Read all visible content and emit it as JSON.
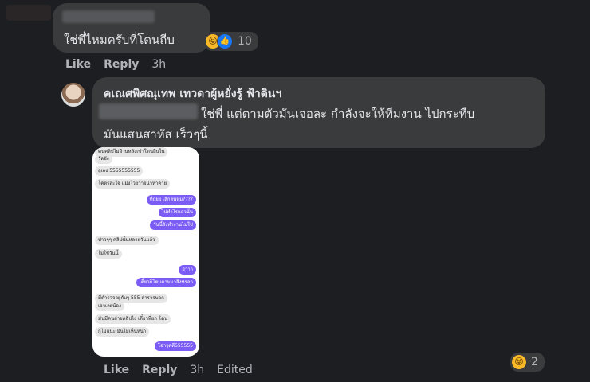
{
  "top_comment": {
    "text": "ใช่พี่ไหมครับที่โดนถีบ",
    "reaction_count": "10",
    "actions": {
      "like": "Like",
      "reply": "Reply",
      "time": "3h"
    }
  },
  "reply": {
    "author": "คเณศพิศณุเทพ เทวดาผู้หยั่งรู้ ฟ้าดินฯ",
    "line1": "ใช่พี่ แต่ตามตัวมันเจอละ กำลังจะให้ทีมงาน ไปกระทืบ",
    "line2": "มันแสนสาหัส เร็วๆนี้",
    "reaction_count": "2",
    "actions": {
      "like": "Like",
      "reply": "Reply",
      "time": "3h",
      "edited": "Edited"
    }
  },
  "chat_screenshot": {
    "messages": [
      {
        "dir": "in",
        "text": "คนคลิปไม่อ้วนหลังเข้าโดนถีบใน"
      },
      {
        "dir": "in",
        "text": "วัดยัง"
      },
      {
        "dir": "in",
        "text": "ถูเลง 5555555555"
      },
      {
        "dir": "in",
        "text": "โคตรสะใจ แม่งไวยวายน่าห่าคาย"
      },
      {
        "dir": "out",
        "text": "ที่ถยย เลิกตพหม????"
      },
      {
        "dir": "out",
        "text": "ไปทำไรแถวนั้น"
      },
      {
        "dir": "out",
        "text": "วันนี้ยังทำงานไม่ใช่"
      },
      {
        "dir": "in",
        "text": "ป่าวๆๆ คลิปนั้นหลายวันแล้ว"
      },
      {
        "dir": "in",
        "text": "ไม่ใช่วันนี้"
      },
      {
        "dir": "out",
        "text": "อ่าาา"
      },
      {
        "dir": "out",
        "text": "เดี๋ยวก็โดนตามมาสิงหรอก"
      },
      {
        "dir": "in",
        "text": "มีตำรวจอยู่กับๆ 555 ตำรวจบอก"
      },
      {
        "dir": "in",
        "text": "เอาเลยน้อง"
      },
      {
        "dir": "in",
        "text": "มันมีคนถ่ายคลิปไง เดี๋ยวพี่ยก โดน"
      },
      {
        "dir": "in",
        "text": "กูไม่แน่ะ มันไม่เห็นหน้า"
      },
      {
        "dir": "out",
        "text": "โอ่าๆดดี555555"
      }
    ]
  }
}
